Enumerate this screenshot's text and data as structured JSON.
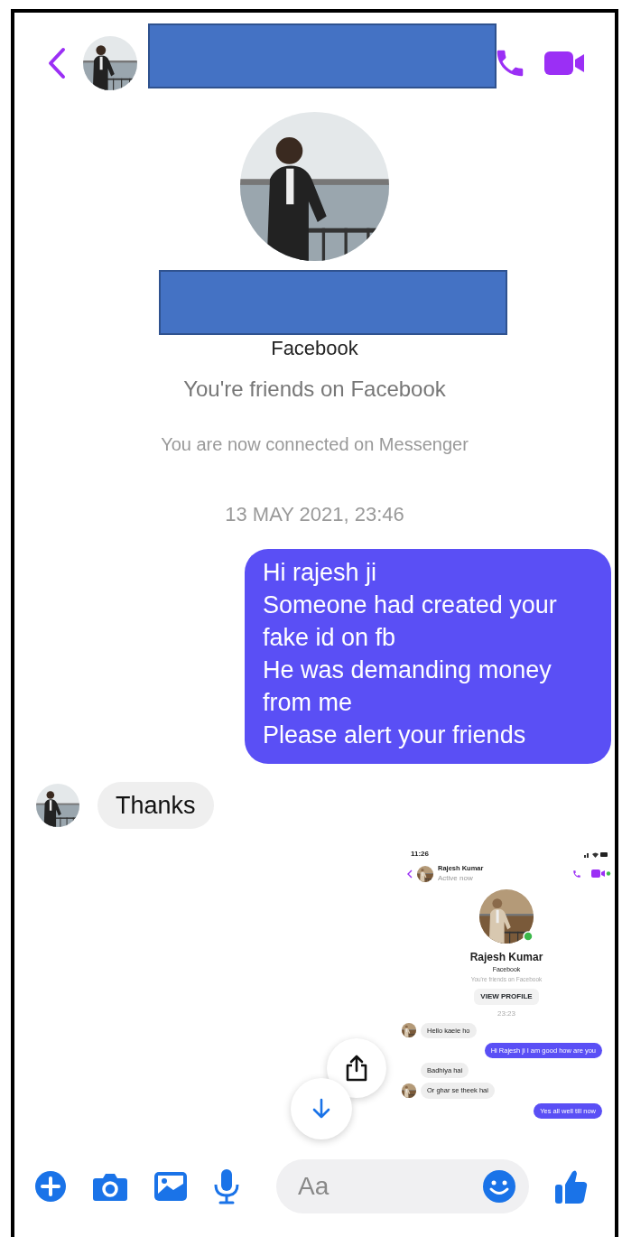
{
  "header": {
    "kind": "chat"
  },
  "profile": {
    "source": "Facebook",
    "friends": "You're friends on Facebook"
  },
  "notice": "You are now connected on Messenger",
  "timestamp": "13 MAY 2021, 23:46",
  "messages": [
    {
      "kind": "outgoing",
      "text": "Hi rajesh ji\nSomeone had created your fake id on fb\nHe was demanding money from me\nPlease alert your friends"
    },
    {
      "kind": "incoming",
      "text": "Thanks"
    }
  ],
  "shared_screenshot": {
    "time": "11:26",
    "contact_name": "Rajesh Kumar",
    "contact_status": "Active now",
    "profile_name": "Rajesh Kumar",
    "profile_source": "Facebook",
    "profile_friends": "You're friends on Facebook",
    "view_profile": "VIEW PROFILE",
    "timestamp": "23:23",
    "messages": [
      {
        "kind": "incoming",
        "avatar": true,
        "text": "Hello kaeie ho"
      },
      {
        "kind": "outgoing",
        "text": "Hi Rajesh ji I am good how are you"
      },
      {
        "kind": "incoming",
        "avatar": false,
        "text": "Badhiya hai"
      },
      {
        "kind": "incoming",
        "avatar": true,
        "text": "Or ghar se theek hai"
      },
      {
        "kind": "outgoing",
        "text": "Yes all well till now"
      }
    ]
  },
  "composer": {
    "placeholder": "Aa"
  }
}
